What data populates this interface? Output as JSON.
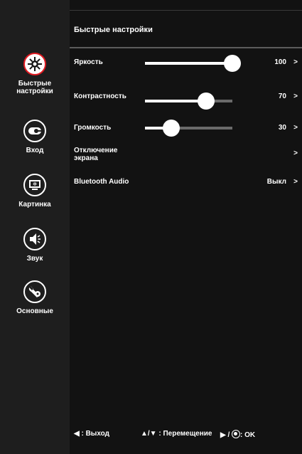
{
  "sidebar": {
    "items": [
      {
        "label": "Быстрые\nнастройки",
        "icon": "gear-icon",
        "active": true
      },
      {
        "label": "Вход",
        "icon": "input-icon",
        "active": false
      },
      {
        "label": "Картинка",
        "icon": "picture-icon",
        "active": false
      },
      {
        "label": "Звук",
        "icon": "speaker-icon",
        "active": false
      },
      {
        "label": "Основные",
        "icon": "tools-icon",
        "active": false
      }
    ]
  },
  "header": {
    "title": "Быстрые настройки"
  },
  "settings": {
    "brightness": {
      "label": "Яркость",
      "value": "100",
      "arrow": ">",
      "level": 100
    },
    "contrast": {
      "label": "Контрастность",
      "value": "70",
      "arrow": ">",
      "level": 70
    },
    "volume": {
      "label": "Громкость",
      "value": "30",
      "arrow": ">",
      "level": 30
    },
    "screen_off": {
      "label": "Отключение\nэкрана",
      "arrow": ">"
    },
    "bluetooth": {
      "label": "Bluetooth Audio",
      "value": "Выкл",
      "arrow": ">"
    }
  },
  "footer": {
    "exit": "◀ : Выход",
    "move": "▲/▼ : Перемещение",
    "ok": ": OK"
  },
  "colors": {
    "accent": "#e11b22",
    "background": "#121212",
    "sidebar": "#1e1e1e"
  }
}
